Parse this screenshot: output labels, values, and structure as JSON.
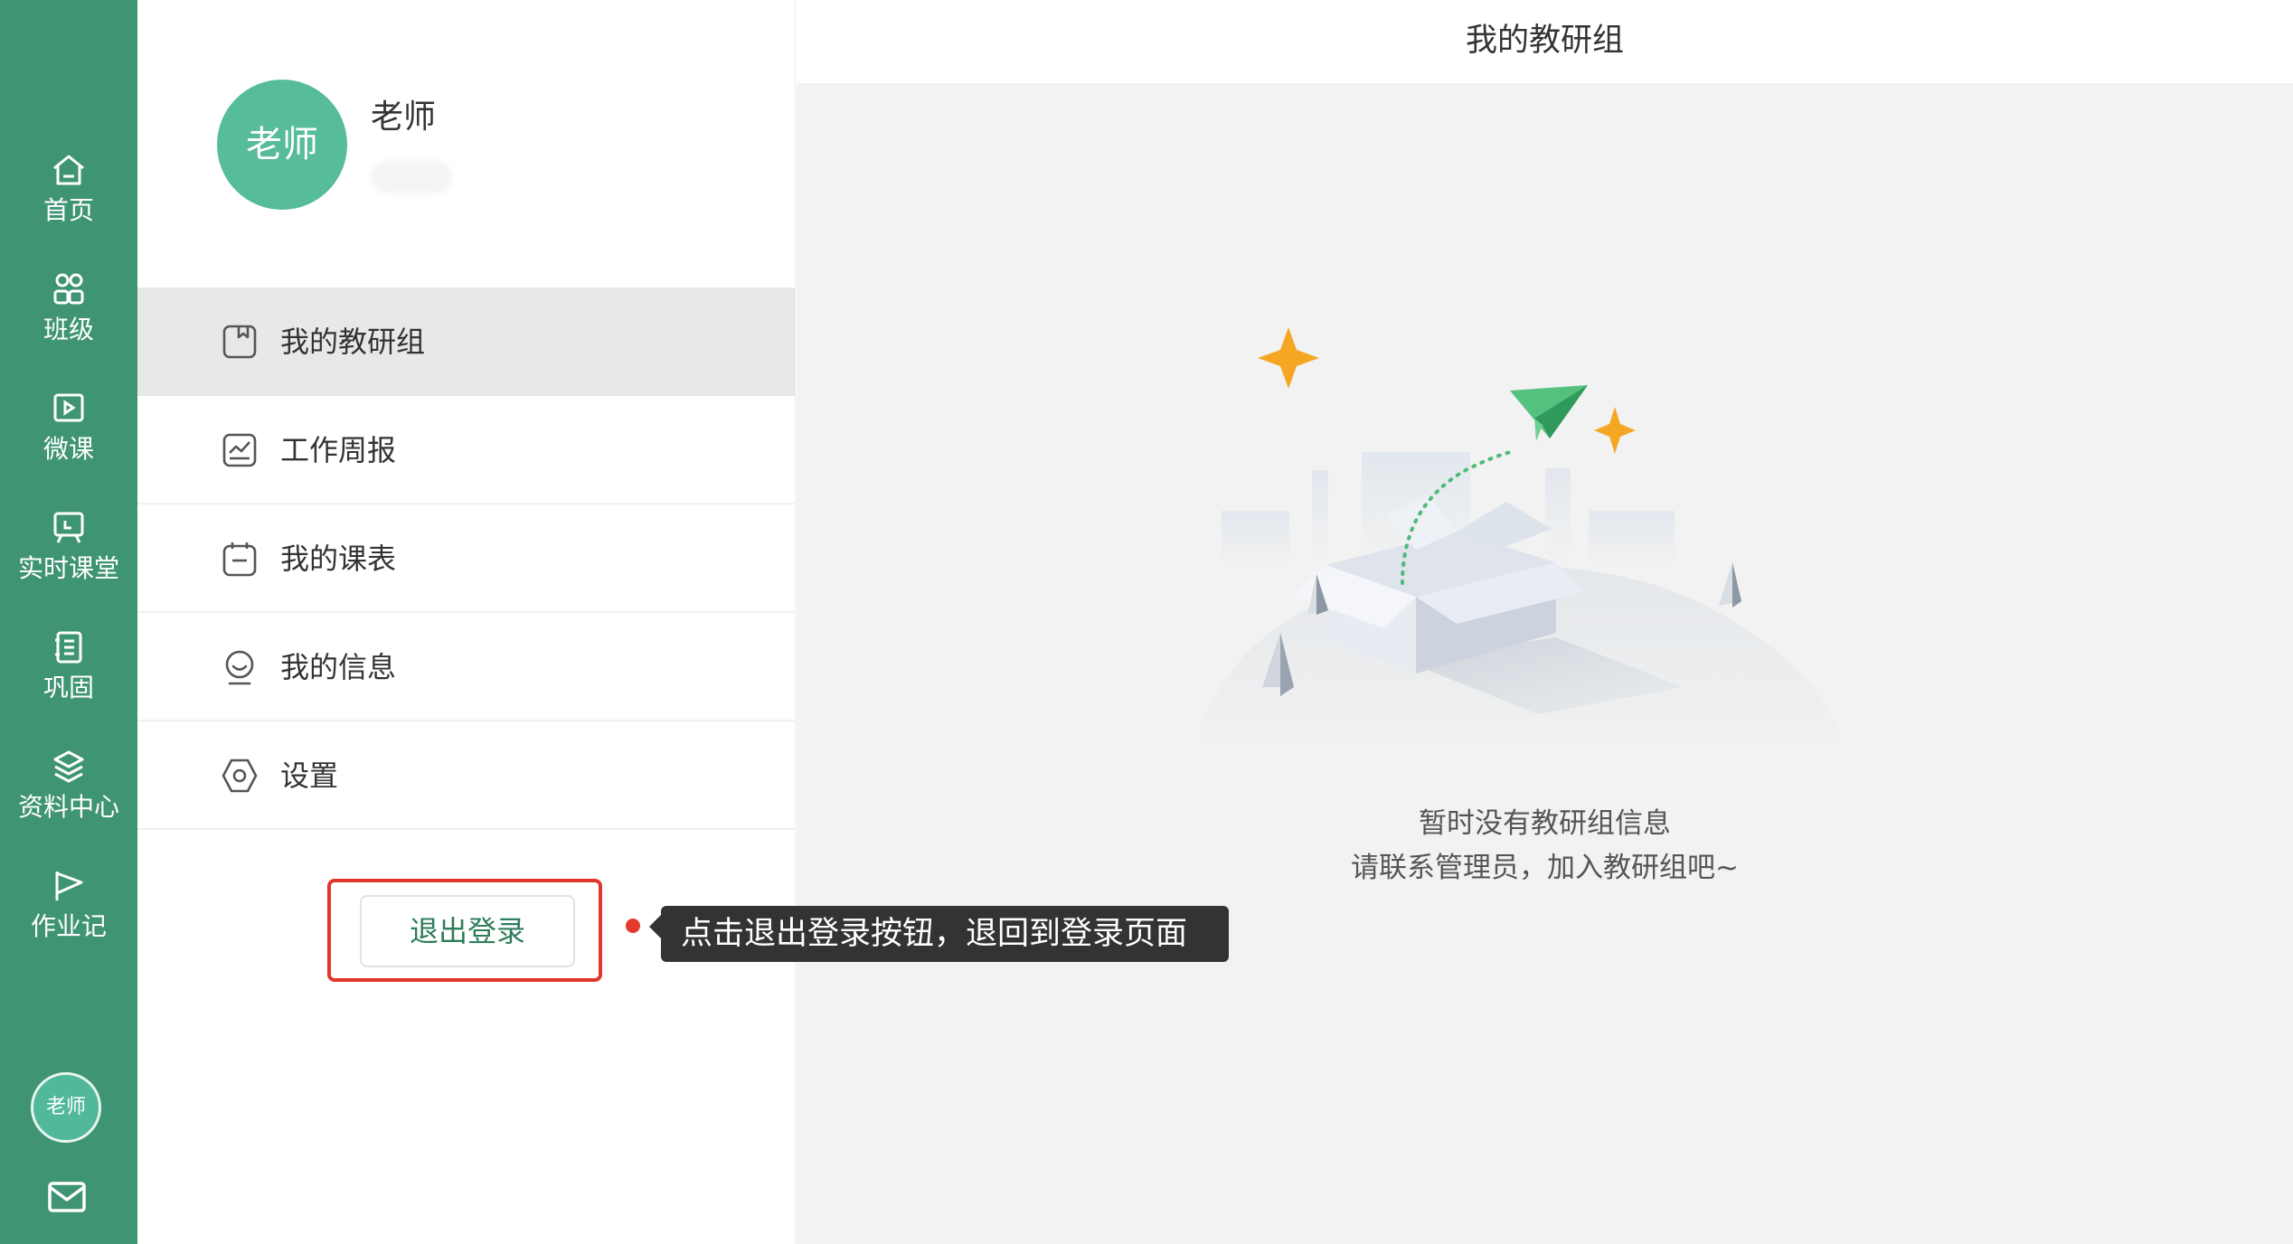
{
  "rail": {
    "items": [
      {
        "label": "首页",
        "icon": "home-icon"
      },
      {
        "label": "班级",
        "icon": "users-icon"
      },
      {
        "label": "微课",
        "icon": "video-icon"
      },
      {
        "label": "实时课堂",
        "icon": "live-board-icon"
      },
      {
        "label": "巩固",
        "icon": "notebook-icon"
      },
      {
        "label": "资料中心",
        "icon": "layers-icon"
      },
      {
        "label": "作业记",
        "icon": "flag-icon"
      }
    ],
    "avatar_text": "老师",
    "bottom_icon": "mail-icon",
    "color": "#3f9473"
  },
  "profile": {
    "avatar_text": "老师",
    "name": "老师",
    "menu": [
      {
        "label": "我的教研组",
        "icon": "bookmark-book-icon",
        "active": true
      },
      {
        "label": "工作周报",
        "icon": "chart-report-icon",
        "active": false
      },
      {
        "label": "我的课表",
        "icon": "calendar-icon",
        "active": false
      },
      {
        "label": "我的信息",
        "icon": "user-info-icon",
        "active": false
      },
      {
        "label": "设置",
        "icon": "settings-icon",
        "active": false
      }
    ],
    "logout_label": "退出登录"
  },
  "tooltip": {
    "text": "点击退出登录按钮，退回到登录页面",
    "highlight_color": "#e0362c"
  },
  "content": {
    "title": "我的教研组",
    "empty_line1": "暂时没有教研组信息",
    "empty_line2": "请联系管理员，加入教研组吧~",
    "illustration": "empty-box-paper-plane-illustration"
  }
}
